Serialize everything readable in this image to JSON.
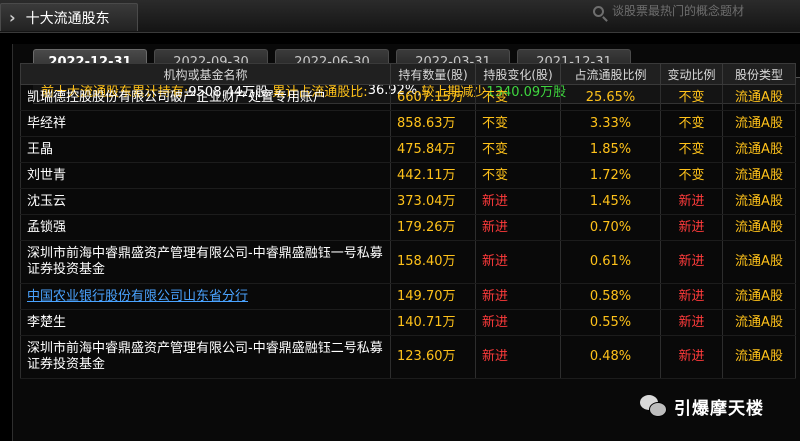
{
  "header": {
    "title": "十大流通股东",
    "search_placeholder": "谈股票最热门的概念题材"
  },
  "tabs": [
    {
      "label": "2022-12-31",
      "active": true
    },
    {
      "label": "2022-09-30",
      "active": false
    },
    {
      "label": "2022-06-30",
      "active": false
    },
    {
      "label": "2022-03-31",
      "active": false
    },
    {
      "label": "2021-12-31",
      "active": false
    }
  ],
  "summary": {
    "holding_label": "前十大流通股东累计持有:",
    "holding_value": "9508.44万股",
    "ratio_label": "累计占流通股比:",
    "ratio_value": "36.92%",
    "change_label": "较上期减少",
    "change_value": "1340.09万股"
  },
  "table": {
    "columns": [
      "机构或基金名称",
      "持有数量(股)",
      "持股变化(股)",
      "占流通股比例",
      "变动比例",
      "股份类型"
    ],
    "rows": [
      {
        "name": "凯瑞德控股股份有限公司破产企业财产处置专用账户",
        "qty": "6607.15万",
        "change": "不变",
        "ratio": "25.65%",
        "change_ratio": "不变",
        "type": "流通A股",
        "is_new": false,
        "link": false
      },
      {
        "name": "毕经祥",
        "qty": "858.63万",
        "change": "不变",
        "ratio": "3.33%",
        "change_ratio": "不变",
        "type": "流通A股",
        "is_new": false,
        "link": false
      },
      {
        "name": "王晶",
        "qty": "475.84万",
        "change": "不变",
        "ratio": "1.85%",
        "change_ratio": "不变",
        "type": "流通A股",
        "is_new": false,
        "link": false
      },
      {
        "name": "刘世青",
        "qty": "442.11万",
        "change": "不变",
        "ratio": "1.72%",
        "change_ratio": "不变",
        "type": "流通A股",
        "is_new": false,
        "link": false
      },
      {
        "name": "沈玉云",
        "qty": "373.04万",
        "change": "新进",
        "ratio": "1.45%",
        "change_ratio": "新进",
        "type": "流通A股",
        "is_new": true,
        "link": false
      },
      {
        "name": "孟锁强",
        "qty": "179.26万",
        "change": "新进",
        "ratio": "0.70%",
        "change_ratio": "新进",
        "type": "流通A股",
        "is_new": true,
        "link": false
      },
      {
        "name": "深圳市前海中睿鼎盛资产管理有限公司-中睿鼎盛融钰一号私募证券投资基金",
        "qty": "158.40万",
        "change": "新进",
        "ratio": "0.61%",
        "change_ratio": "新进",
        "type": "流通A股",
        "is_new": true,
        "link": false,
        "tall": true
      },
      {
        "name": "中国农业银行股份有限公司山东省分行",
        "qty": "149.70万",
        "change": "新进",
        "ratio": "0.58%",
        "change_ratio": "新进",
        "type": "流通A股",
        "is_new": true,
        "link": true
      },
      {
        "name": "李楚生",
        "qty": "140.71万",
        "change": "新进",
        "ratio": "0.55%",
        "change_ratio": "新进",
        "type": "流通A股",
        "is_new": true,
        "link": false
      },
      {
        "name": "深圳市前海中睿鼎盛资产管理有限公司-中睿鼎盛融钰二号私募证券投资基金",
        "qty": "123.60万",
        "change": "新进",
        "ratio": "0.48%",
        "change_ratio": "新进",
        "type": "流通A股",
        "is_new": true,
        "link": false,
        "tall": true
      }
    ]
  },
  "watermark": {
    "text": "引爆摩天楼",
    "icon": "wechat-icon"
  },
  "colors": {
    "accent": "#ffc21a",
    "new": "#ff3b3b",
    "decrease": "#3fd63f",
    "link": "#4aa3ff"
  }
}
